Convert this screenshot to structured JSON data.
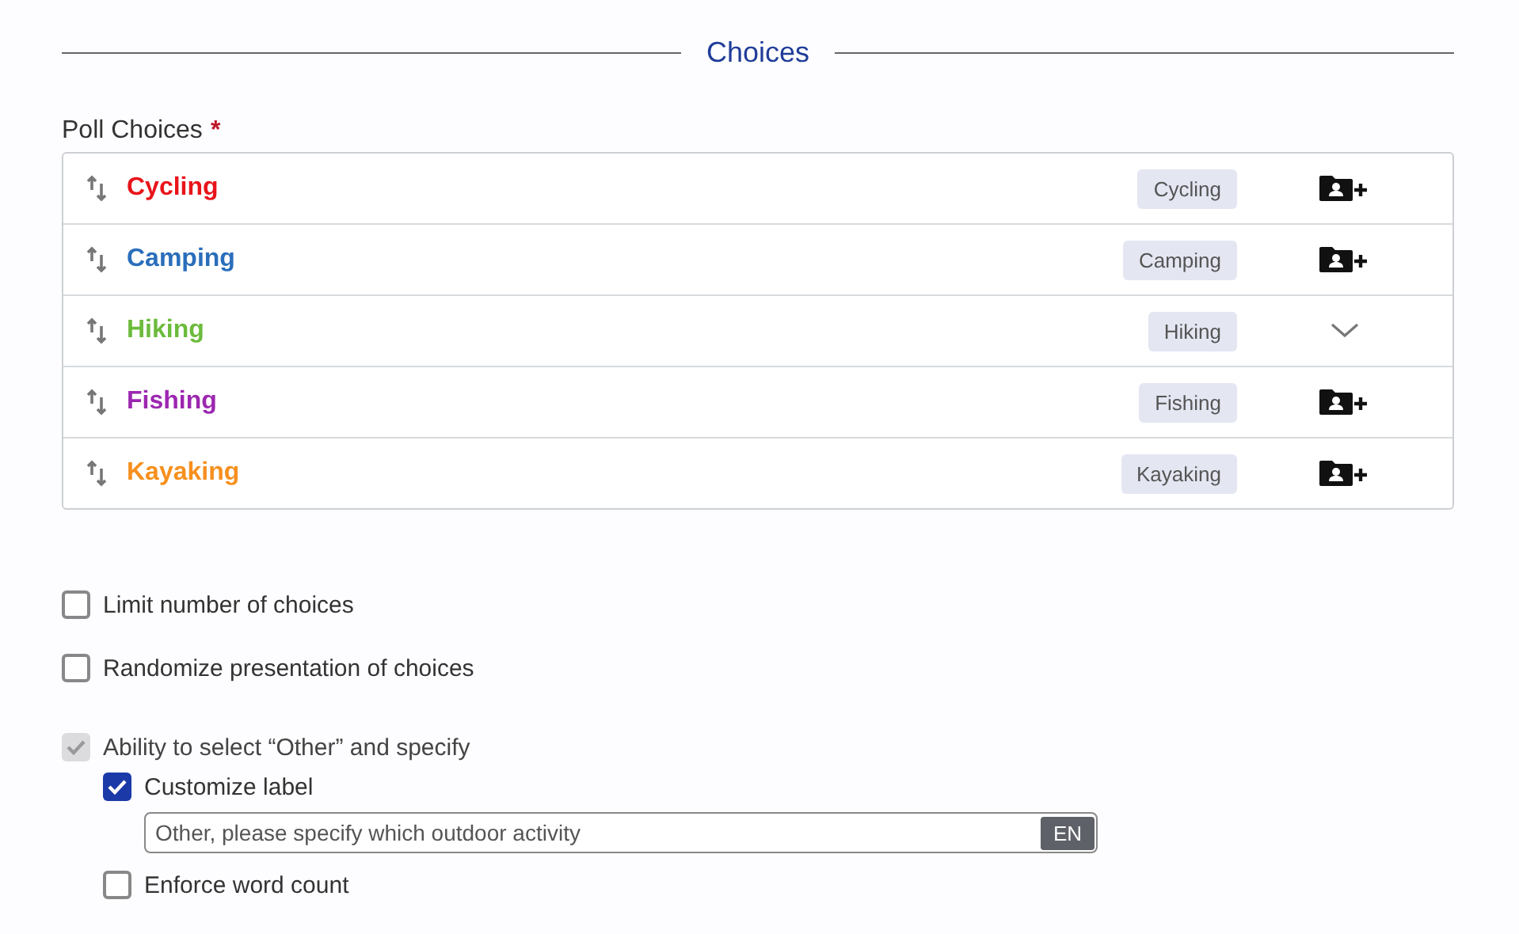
{
  "section_title": "Choices",
  "poll_choices": {
    "label": "Poll Choices",
    "required_mark": "*",
    "items": [
      {
        "name": "Cycling",
        "color": "#e8141b",
        "tag": "Cycling",
        "kind": "add"
      },
      {
        "name": "Camping",
        "color": "#2a6ebb",
        "tag": "Camping",
        "kind": "add"
      },
      {
        "name": "Hiking",
        "color": "#6cbb3c",
        "tag": "Hiking",
        "kind": "expand"
      },
      {
        "name": "Fishing",
        "color": "#9c27b0",
        "tag": "Fishing",
        "kind": "add"
      },
      {
        "name": "Kayaking",
        "color": "#f7901e",
        "tag": "Kayaking",
        "kind": "add"
      }
    ]
  },
  "options": [
    {
      "label": "Limit number of choices",
      "checked": false,
      "disabled": false
    },
    {
      "label": "Randomize presentation of choices",
      "checked": false,
      "disabled": false
    },
    {
      "label": "Ability to select “Other” and specify",
      "checked": true,
      "disabled": true,
      "children": [
        {
          "label": "Customize label",
          "checked": true,
          "disabled": false,
          "field": {
            "value": "Other, please specify which outdoor activity",
            "language": "EN"
          }
        },
        {
          "label": "Enforce word count",
          "checked": false,
          "disabled": false
        }
      ]
    }
  ]
}
